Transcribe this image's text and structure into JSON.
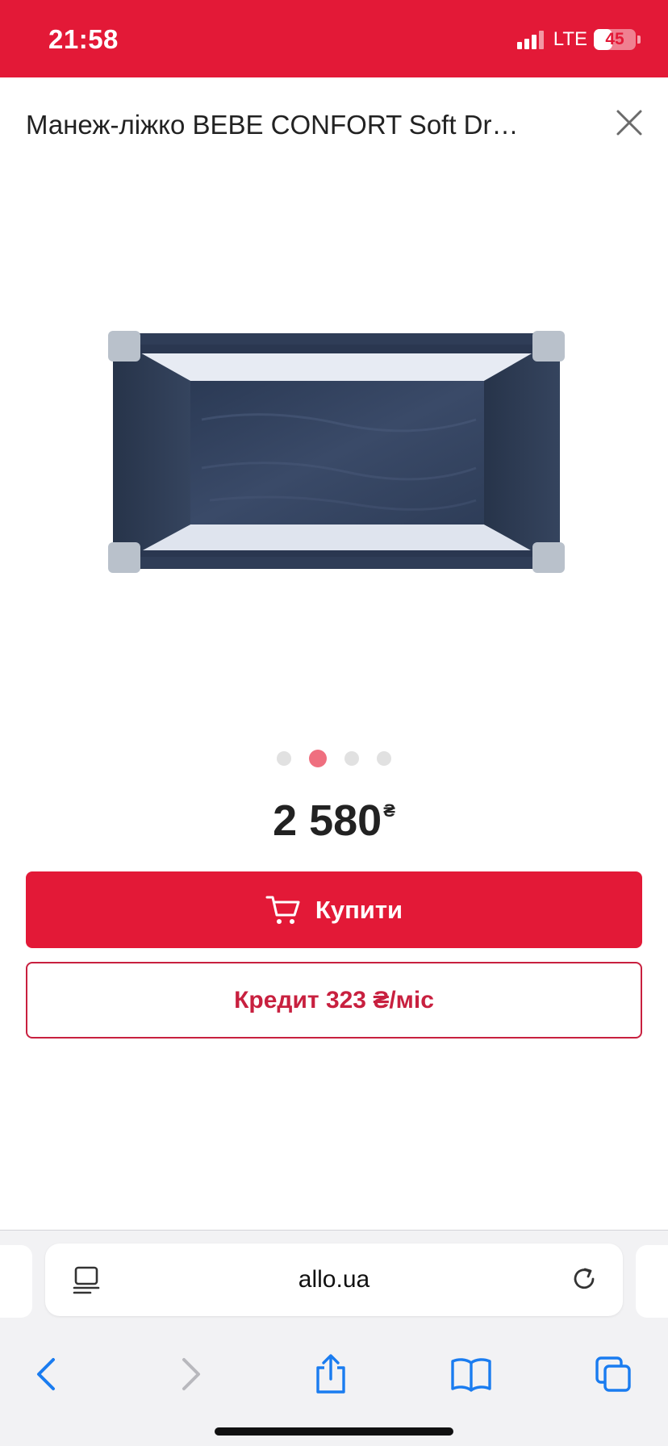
{
  "status_bar": {
    "time": "21:58",
    "network": "LTE",
    "battery": "45",
    "battery_level": 0.45,
    "background_color": "#e31937"
  },
  "product": {
    "title": "Манеж-ліжко BEBE CONFORT Soft Dr…",
    "close_icon": "close-icon",
    "image_name": "travel-cot-top-view-image",
    "gallery": {
      "total": 4,
      "active_index": 1
    },
    "price_value": "2 580",
    "price_currency": "₴"
  },
  "actions": {
    "buy_label": "Купити",
    "buy_icon": "cart-icon",
    "credit_label": "Кредит 323 ₴/міс",
    "accent_color": "#e31937"
  },
  "browser": {
    "url": "allo.ua",
    "reader_icon": "reader-icon",
    "reload_icon": "reload-icon",
    "nav_icons": [
      "back-icon",
      "forward-icon",
      "share-icon",
      "bookmarks-icon",
      "tabs-icon"
    ],
    "tint_color": "#1a7cf0"
  }
}
